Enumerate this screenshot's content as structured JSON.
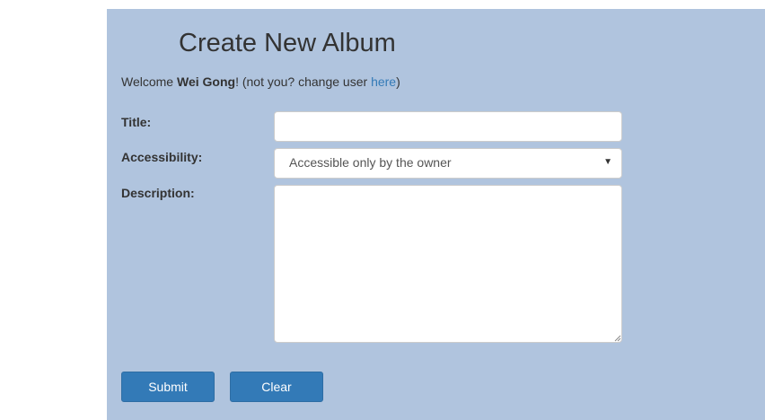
{
  "page": {
    "title": "Create New Album"
  },
  "welcome": {
    "prefix": "Welcome ",
    "user": "Wei Gong",
    "middle": "! (not you? change user ",
    "link": "here",
    "suffix": ")"
  },
  "form": {
    "title_label": "Title:",
    "title_value": "",
    "accessibility_label": "Accessibility:",
    "accessibility_selected": "Accessible only by the owner",
    "description_label": "Description:",
    "description_value": ""
  },
  "buttons": {
    "submit": "Submit",
    "clear": "Clear"
  },
  "icons": {
    "select_arrow": "chevron-down-icon",
    "resize_grip": "resize-grip-icon"
  }
}
